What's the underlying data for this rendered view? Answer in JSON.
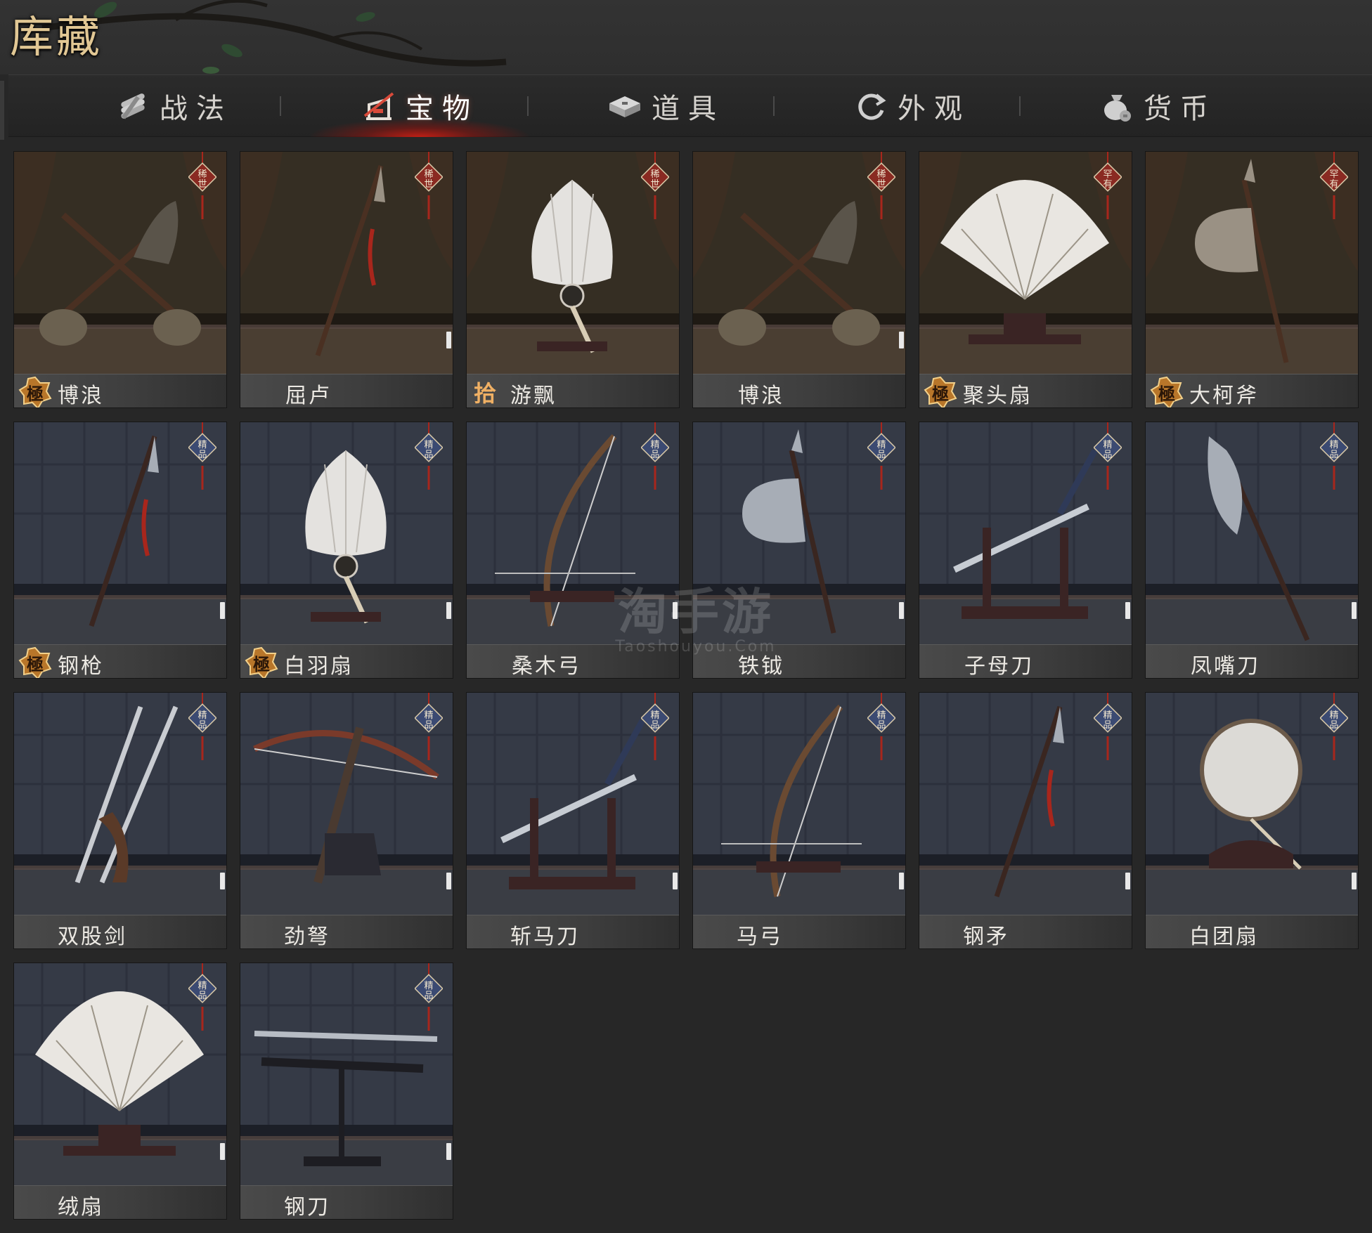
{
  "header": {
    "title": "库藏"
  },
  "tabs": [
    {
      "label": "战法",
      "icon": "scroll-bundle-icon",
      "active": false
    },
    {
      "label": "宝物",
      "icon": "weapon-rack-icon",
      "active": true
    },
    {
      "label": "道具",
      "icon": "box-icon",
      "active": false
    },
    {
      "label": "外观",
      "icon": "refresh-swirl-icon",
      "active": false
    },
    {
      "label": "货币",
      "icon": "money-bag-icon",
      "active": false
    }
  ],
  "badges": {
    "legendary": "稀世",
    "rare": "罕有",
    "fine": "精品"
  },
  "quality_marks": {
    "ji": "極",
    "shi": "拾"
  },
  "items": [
    {
      "name": "博浪",
      "badge": "legendary",
      "quality": "ji",
      "scene": "warm",
      "weapon": "hammers"
    },
    {
      "name": "屈卢",
      "badge": "legendary",
      "quality": "",
      "scene": "warm",
      "weapon": "spear"
    },
    {
      "name": "游飘",
      "badge": "legendary",
      "quality": "shi",
      "scene": "warm",
      "weapon": "featherfan"
    },
    {
      "name": "博浪",
      "badge": "legendary",
      "quality": "",
      "scene": "warm",
      "weapon": "hammers"
    },
    {
      "name": "聚头扇",
      "badge": "rare",
      "quality": "ji",
      "scene": "warm",
      "weapon": "foldfan"
    },
    {
      "name": "大柯斧",
      "badge": "rare",
      "quality": "ji",
      "scene": "warm",
      "weapon": "axe"
    },
    {
      "name": "钢枪",
      "badge": "fine",
      "quality": "ji",
      "scene": "cool",
      "weapon": "spear"
    },
    {
      "name": "白羽扇",
      "badge": "fine",
      "quality": "ji",
      "scene": "cool",
      "weapon": "featherfan"
    },
    {
      "name": "桑木弓",
      "badge": "fine",
      "quality": "",
      "scene": "cool",
      "weapon": "bow"
    },
    {
      "name": "铁钺",
      "badge": "fine",
      "quality": "",
      "scene": "cool",
      "weapon": "axe"
    },
    {
      "name": "子母刀",
      "badge": "fine",
      "quality": "",
      "scene": "cool",
      "weapon": "swordrack"
    },
    {
      "name": "凤嘴刀",
      "badge": "fine",
      "quality": "",
      "scene": "cool",
      "weapon": "glaive"
    },
    {
      "name": "双股剑",
      "badge": "fine",
      "quality": "",
      "scene": "cool",
      "weapon": "twinswords"
    },
    {
      "name": "劲弩",
      "badge": "fine",
      "quality": "",
      "scene": "cool",
      "weapon": "crossbow"
    },
    {
      "name": "斩马刀",
      "badge": "fine",
      "quality": "",
      "scene": "cool",
      "weapon": "swordrack"
    },
    {
      "name": "马弓",
      "badge": "fine",
      "quality": "",
      "scene": "cool",
      "weapon": "bow"
    },
    {
      "name": "钢矛",
      "badge": "fine",
      "quality": "",
      "scene": "cool",
      "weapon": "spear"
    },
    {
      "name": "白团扇",
      "badge": "fine",
      "quality": "",
      "scene": "cool",
      "weapon": "roundfan"
    },
    {
      "name": "绒扇",
      "badge": "fine",
      "quality": "",
      "scene": "cool",
      "weapon": "foldfan"
    },
    {
      "name": "钢刀",
      "badge": "fine",
      "quality": "",
      "scene": "cool",
      "weapon": "sabre"
    }
  ],
  "watermark": {
    "big": "淘手游",
    "small": "Taoshouyou.Com"
  },
  "colors": {
    "title_gold": "#e1c794",
    "active_tab_glow": "#c81e14",
    "badge_legendary": "#8a2a22",
    "badge_fine": "#3b4a72"
  }
}
